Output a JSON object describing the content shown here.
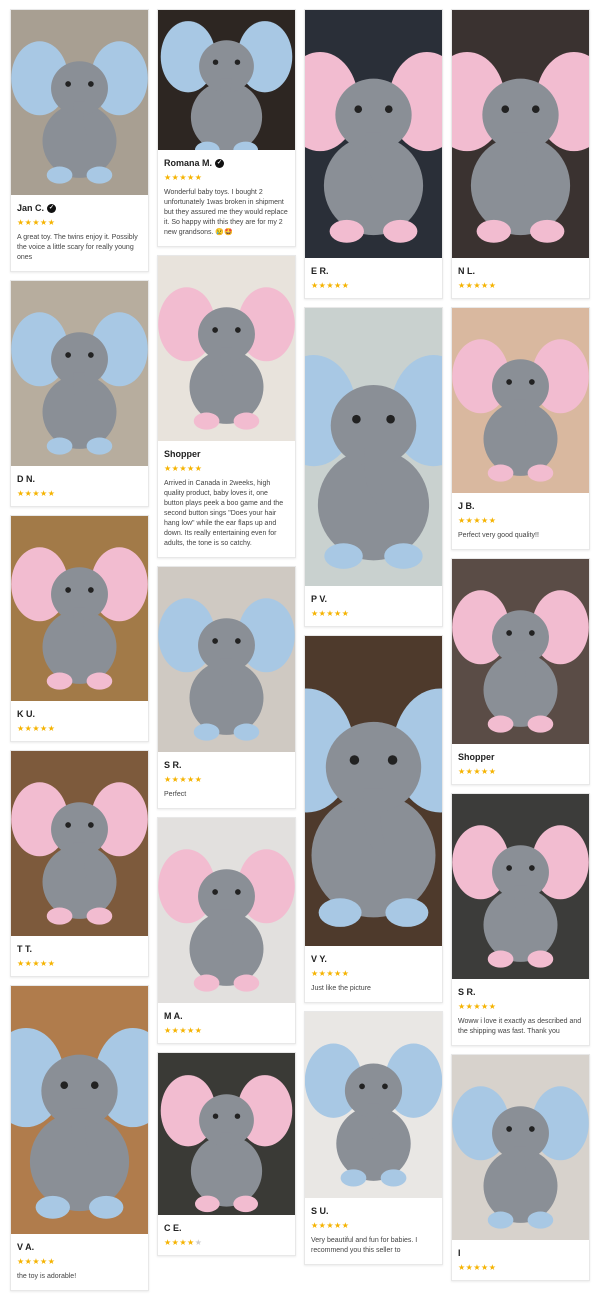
{
  "colors": {
    "star": "#f5b301",
    "blue_ear": "#a8c8e4",
    "pink_ear": "#f2bcd0",
    "gray_body": "#8a8f96"
  },
  "columns": [
    [
      {
        "name": "Jan C.",
        "verified": true,
        "stars": 5,
        "text": "A great toy. The twins enjoy it. Possibly the voice a little scary for really young ones",
        "h": 185,
        "bg": "#a89f92",
        "ear": "blue"
      },
      {
        "name": "D N.",
        "verified": false,
        "stars": 5,
        "text": "",
        "h": 185,
        "bg": "#b7ad9e",
        "ear": "blue"
      },
      {
        "name": "K U.",
        "verified": false,
        "stars": 5,
        "text": "",
        "h": 185,
        "bg": "#a27a48",
        "ear": "pink"
      },
      {
        "name": "T T.",
        "verified": false,
        "stars": 5,
        "text": "",
        "h": 185,
        "bg": "#7d5a3c",
        "ear": "pink"
      },
      {
        "name": "V A.",
        "verified": false,
        "stars": 5,
        "text": "the toy is adorable!",
        "h": 248,
        "bg": "#b07c4c",
        "ear": "blue"
      }
    ],
    [
      {
        "name": "Romana M.",
        "verified": true,
        "stars": 5,
        "text": "Wonderful baby toys. I bought 2 unfortunately 1was broken in shipment but they assured me they would replace it. So happy with this they are for my 2 new grandsons. 😢🤩",
        "h": 140,
        "bg": "#2d2622",
        "ear": "blue"
      },
      {
        "name": "Shopper",
        "verified": false,
        "stars": 5,
        "text": "Arrived in Canada in 2weeks, high quality product, baby loves it, one button plays peek a boo game and the second button sings \"Does your hair hang low\" while the ear flaps up and down. Its really entertaining even for adults, the tone is so catchy.",
        "h": 185,
        "bg": "#e8e3dc",
        "ear": "pink"
      },
      {
        "name": "S R.",
        "verified": false,
        "stars": 5,
        "text": "Perfect",
        "h": 185,
        "bg": "#cfc9c2",
        "ear": "blue"
      },
      {
        "name": "M A.",
        "verified": false,
        "stars": 5,
        "text": "",
        "h": 185,
        "bg": "#e2e0de",
        "ear": "pink"
      },
      {
        "name": "C E.",
        "verified": false,
        "stars": 4,
        "text": "",
        "h": 162,
        "bg": "#3a3a36",
        "ear": "pink"
      }
    ],
    [
      {
        "name": "E R.",
        "verified": false,
        "stars": 5,
        "text": "",
        "h": 248,
        "bg": "#2a2f38",
        "ear": "pink"
      },
      {
        "name": "P V.",
        "verified": false,
        "stars": 5,
        "text": "",
        "h": 278,
        "bg": "#c9d1cf",
        "ear": "blue"
      },
      {
        "name": "V Y.",
        "verified": false,
        "stars": 5,
        "text": "Just like the picture",
        "h": 310,
        "bg": "#4e3a2c",
        "ear": "blue"
      },
      {
        "name": "S U.",
        "verified": false,
        "stars": 5,
        "text": "Very beautiful and fun for babies. I recommend you this seller to",
        "h": 186,
        "bg": "#e9e7e4",
        "ear": "blue"
      }
    ],
    [
      {
        "name": "N L.",
        "verified": false,
        "stars": 5,
        "text": "",
        "h": 248,
        "bg": "#3a3230",
        "ear": "pink"
      },
      {
        "name": "J B.",
        "verified": false,
        "stars": 5,
        "text": "Perfect very good quality!!",
        "h": 185,
        "bg": "#d9b89f",
        "ear": "pink"
      },
      {
        "name": "Shopper",
        "verified": false,
        "stars": 5,
        "text": "",
        "h": 185,
        "bg": "#5a4c46",
        "ear": "pink"
      },
      {
        "name": "S R.",
        "verified": false,
        "stars": 5,
        "text": "Woww i love it exactly as described and the shipping was fast. Thank you",
        "h": 185,
        "bg": "#3c3c3a",
        "ear": "pink"
      },
      {
        "name": "I",
        "verified": false,
        "stars": 5,
        "text": "",
        "h": 185,
        "bg": "#d7d2cc",
        "ear": "blue"
      }
    ]
  ]
}
